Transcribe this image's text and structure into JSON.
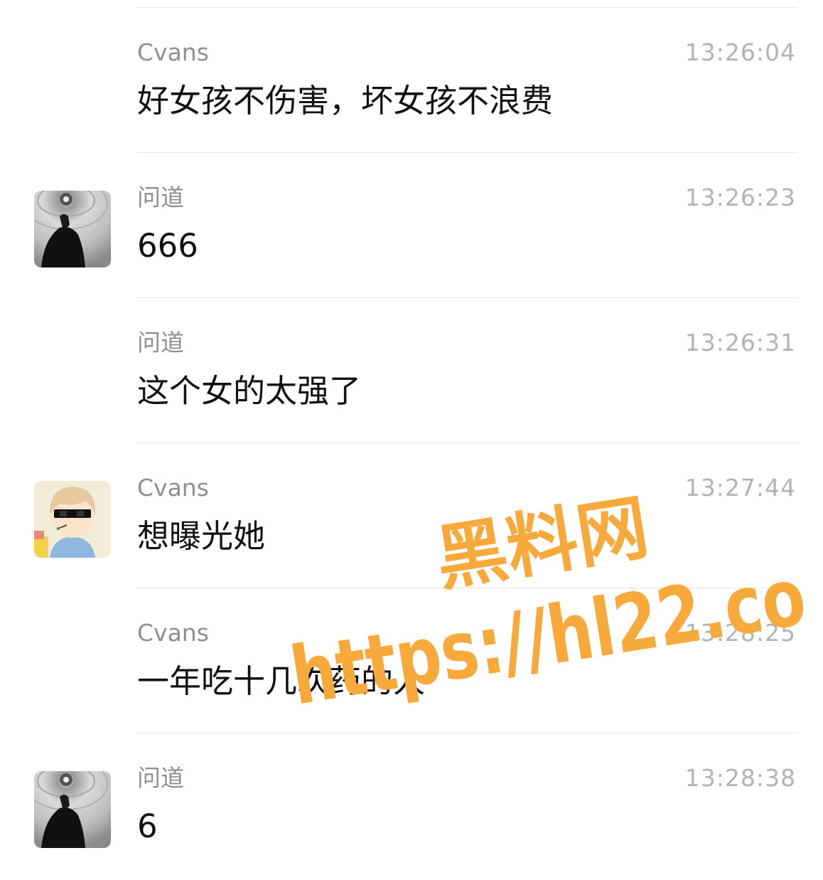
{
  "messages": [
    {
      "sender": "Cvans",
      "time": "13:26:04",
      "content": "好女孩不伤害，坏女孩不浪费",
      "avatar": "none"
    },
    {
      "sender": "问道",
      "time": "13:26:23",
      "content": "666",
      "avatar": "wendao-avatar"
    },
    {
      "sender": "问道",
      "time": "13:26:31",
      "content": "这个女的太强了",
      "avatar": "none"
    },
    {
      "sender": "Cvans",
      "time": "13:27:44",
      "content": "想曝光她",
      "avatar": "cvans-avatar"
    },
    {
      "sender": "Cvans",
      "time": "13:28:25",
      "content": "一年吃十几次药的人",
      "avatar": "none"
    },
    {
      "sender": "问道",
      "time": "13:28:38",
      "content": "6",
      "avatar": "wendao-avatar"
    }
  ],
  "watermark": {
    "title": "黑料网",
    "url": "https://hl22.co",
    "color": "#f7a93b"
  }
}
